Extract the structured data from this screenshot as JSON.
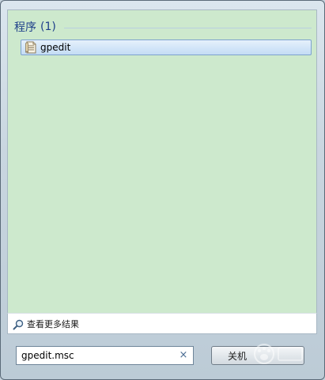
{
  "results": {
    "group_title": "程序",
    "group_count": "(1)",
    "items": [
      {
        "label": "gpedit",
        "icon": "document-icon"
      }
    ]
  },
  "see_more": {
    "label": "查看更多结果",
    "icon": "search-icon"
  },
  "search": {
    "value": "gpedit.msc",
    "clear_icon": "×"
  },
  "shutdown": {
    "label": "关机"
  }
}
